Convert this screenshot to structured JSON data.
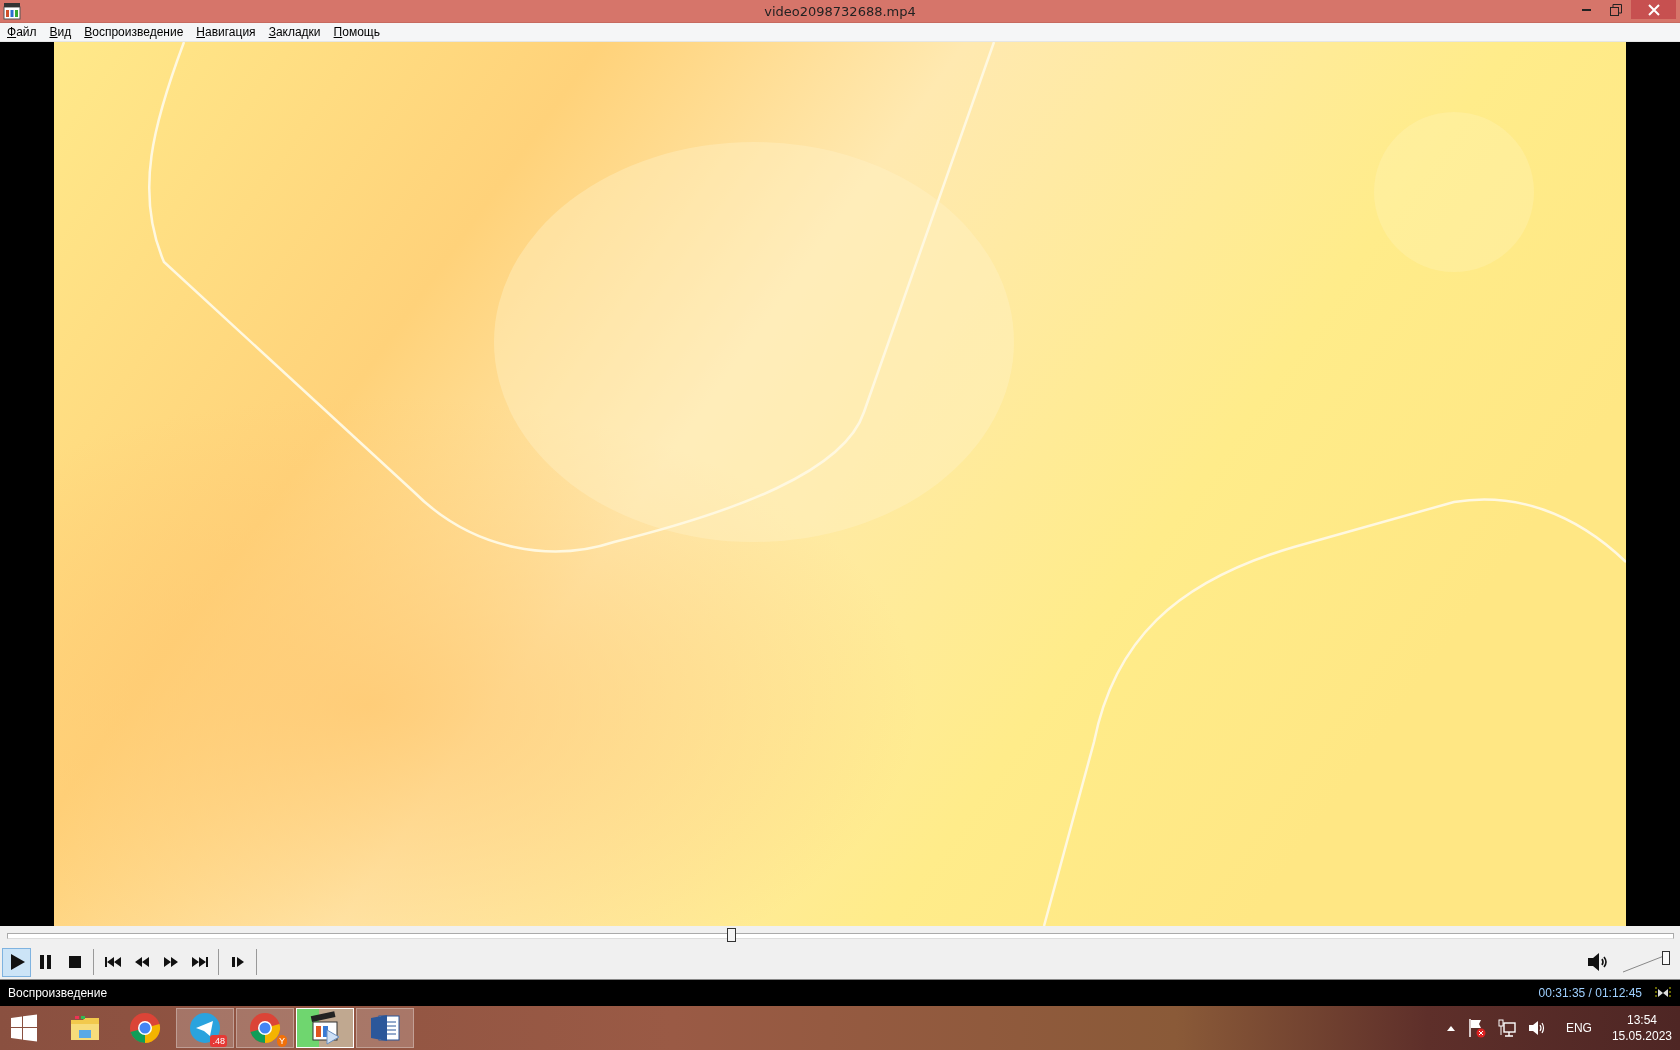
{
  "window": {
    "title": "video2098732688.mp4"
  },
  "menu": [
    {
      "label": "Файл",
      "underline_first": true
    },
    {
      "label": "Вид",
      "underline_first": true
    },
    {
      "label": "Воспроизведение",
      "underline_first": true
    },
    {
      "label": "Навигация",
      "underline_first": true
    },
    {
      "label": "Закладки",
      "underline_first": true
    },
    {
      "label": "Помощь",
      "underline_first": true
    }
  ],
  "seek": {
    "level": 0.434
  },
  "controls": [
    {
      "kind": "play",
      "pressed": true
    },
    {
      "kind": "pause",
      "pressed": false
    },
    {
      "kind": "stop",
      "pressed": false
    },
    {
      "kind": "separator"
    },
    {
      "kind": "prev",
      "pressed": false
    },
    {
      "kind": "rewind",
      "pressed": false
    },
    {
      "kind": "forward",
      "pressed": false
    },
    {
      "kind": "next",
      "pressed": false
    },
    {
      "kind": "separator"
    },
    {
      "kind": "frame-step",
      "pressed": false
    },
    {
      "kind": "separator"
    }
  ],
  "volume": {
    "muted": false,
    "level": 1
  },
  "status_bar": {
    "state": "Воспроизведение",
    "time": "00:31:35 / 01:12:45"
  },
  "taskbar": {
    "items": [
      {
        "kind": "explorer",
        "running": false,
        "selected": false
      },
      {
        "kind": "chrome",
        "running": false,
        "selected": false
      },
      {
        "kind": "telegram",
        "running": true,
        "selected": false,
        "badge": ".48"
      },
      {
        "kind": "chrome-profile",
        "running": true,
        "selected": false,
        "badge": "Y"
      },
      {
        "kind": "player",
        "running": true,
        "selected": true
      },
      {
        "kind": "word",
        "running": true,
        "selected": false
      }
    ],
    "tray": {
      "language": "ENG",
      "time": "13:54",
      "date": "15.05.2023"
    }
  }
}
